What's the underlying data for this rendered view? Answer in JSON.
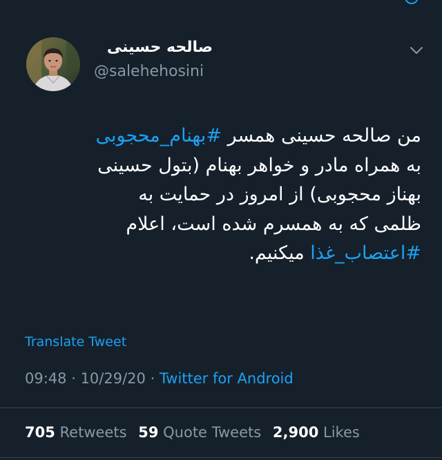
{
  "user": {
    "display_name": "صالحه حسینی",
    "handle": "@salehehosini"
  },
  "tweet": {
    "lines": [
      [
        {
          "text": "من صالحه حسینی همسر ",
          "hashtag": false
        },
        {
          "text": "#بهنام_محجوبی",
          "hashtag": true
        }
      ],
      [
        {
          "text": "به همراه مادر و خواهر بهنام (بتول حسینی",
          "hashtag": false
        }
      ],
      [
        {
          "text": "بهناز محجوبی) از امروز در حمایت به",
          "hashtag": false
        }
      ],
      [
        {
          "text": "ظلمی که به همسرم شده است، اعلام",
          "hashtag": false
        }
      ],
      [
        {
          "text": "#اعتصاب_غذا",
          "hashtag": true
        },
        {
          "text": " میکنیم.",
          "hashtag": false
        }
      ]
    ]
  },
  "translate_label": "Translate Tweet",
  "meta": {
    "time": "09:48",
    "separator": " · ",
    "date": "10/29/20",
    "source": "Twitter for Android"
  },
  "stats": {
    "retweets_count": "705",
    "retweets_label": "Retweets",
    "quotes_count": "59",
    "quotes_label": "Quote Tweets",
    "likes_count": "2,900",
    "likes_label": "Likes"
  },
  "colors": {
    "background": "#15202b",
    "text": "#ffffff",
    "secondary": "#8899a6",
    "accent": "#1da1f2",
    "divider": "#38444d"
  },
  "icons": {
    "more": "chevron-down-icon"
  }
}
